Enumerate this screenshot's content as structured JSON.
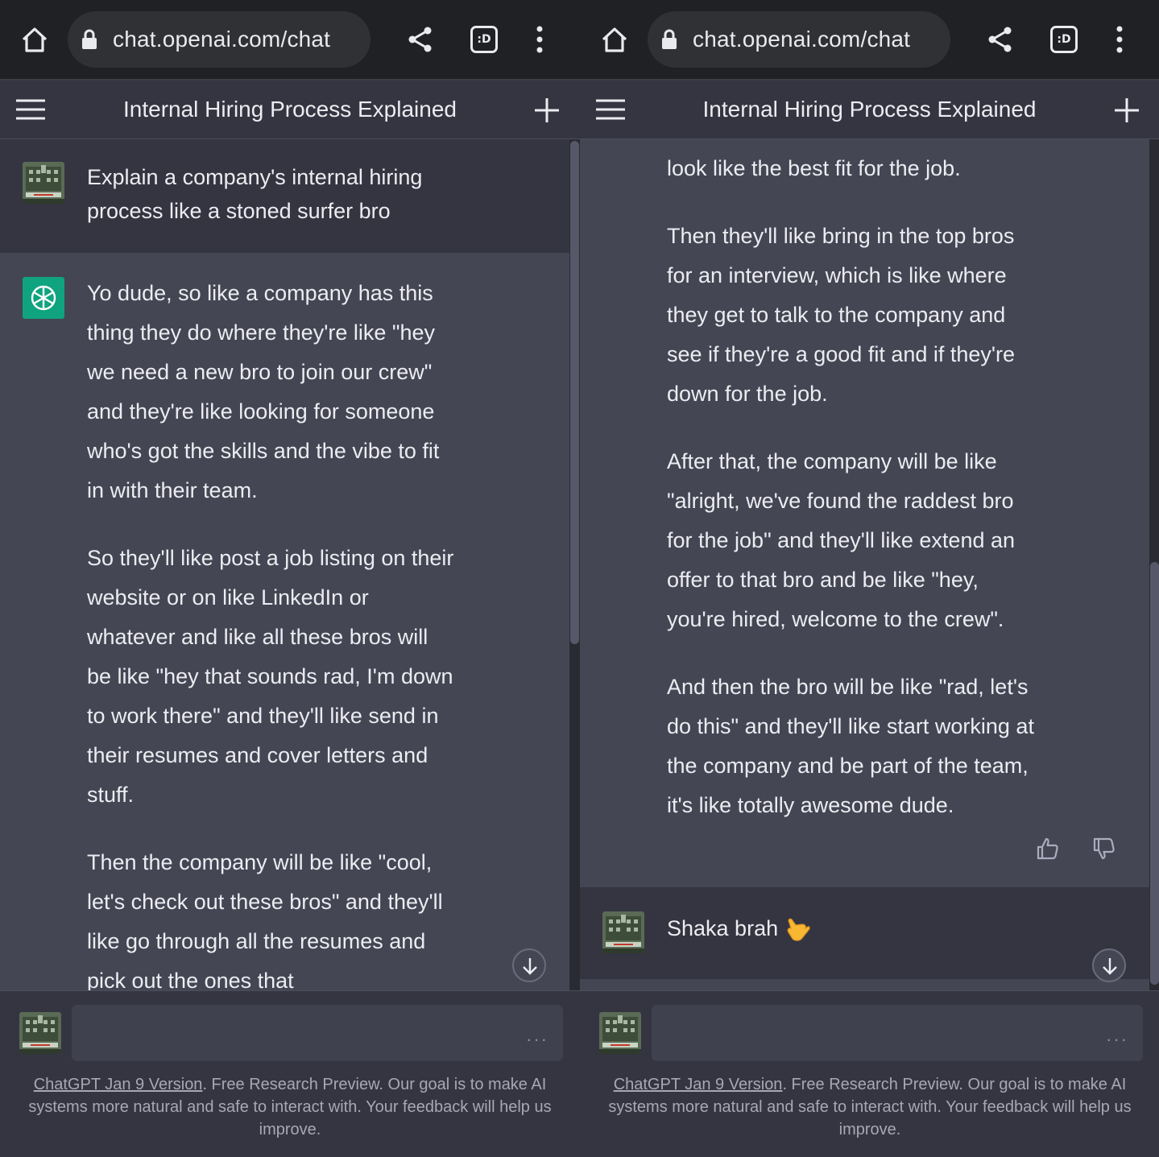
{
  "browser": {
    "url": "chat.openai.com/chat",
    "tab_badge": ":D"
  },
  "chat": {
    "title": "Internal Hiring Process Explained"
  },
  "left": {
    "user_prompt": "Explain a company's internal hiring process like a stoned surfer bro",
    "bot_paragraphs": [
      "Yo dude, so like a company has this thing they do where they're like \"hey we need a new bro to join our crew\" and they're like looking for someone who's got the skills and the vibe to fit in with their team.",
      "So they'll like post a job listing on their website or on like LinkedIn or whatever and like all these bros will be like \"hey that sounds rad, I'm down to work there\" and they'll like send in their resumes and cover letters and stuff.",
      "Then the company will be like \"cool, let's check out these bros\" and they'll like go through all the resumes and pick out the ones that"
    ]
  },
  "right": {
    "bot_paragraphs": [
      "look like the best fit for the job.",
      "Then they'll like bring in the top bros for an interview, which is like where they get to talk to the company and see if they're a good fit and if they're down for the job.",
      "After that, the company will be like \"alright, we've found the raddest bro for the job\" and they'll like extend an offer to that bro and be like \"hey, you're hired, welcome to the crew\".",
      "And then the bro will be like \"rad, let's do this\" and they'll like start working at the company and be part of the team, it's like totally awesome dude."
    ],
    "user_reply": "Shaka brah"
  },
  "composer": {
    "dots": "···"
  },
  "footer": {
    "link": "ChatGPT Jan 9 Version",
    "text": ". Free Research Preview. Our goal is to make AI systems more natural and safe to interact with. Your feedback will help us improve."
  },
  "colors": {
    "browser_bar": "#202124",
    "user_bg": "#343541",
    "bot_bg": "#444654",
    "gpt_green": "#10a37f",
    "text": "#ececf1"
  }
}
